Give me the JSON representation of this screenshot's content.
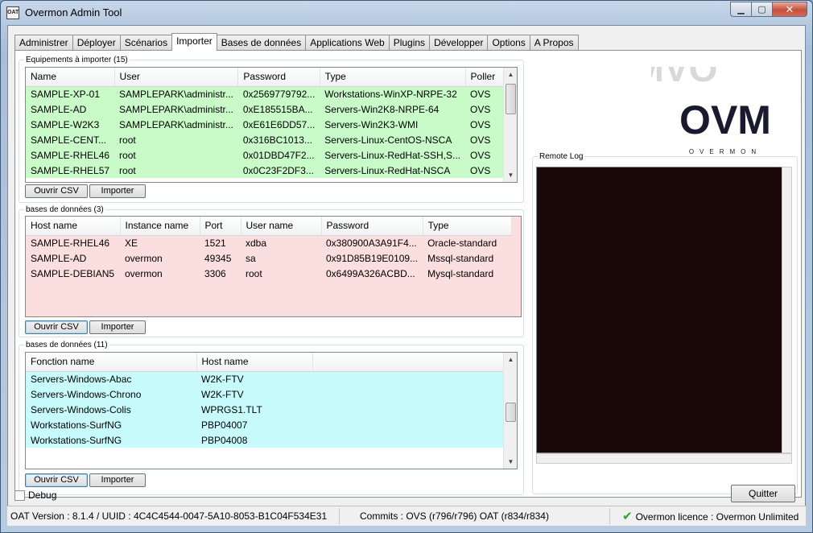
{
  "window": {
    "title": "Overmon Admin Tool",
    "app_icon_text": "OAT"
  },
  "tabs": [
    {
      "label": "Administrer"
    },
    {
      "label": "Déployer"
    },
    {
      "label": "Scénarios"
    },
    {
      "label": "Importer"
    },
    {
      "label": "Bases de données"
    },
    {
      "label": "Applications Web"
    },
    {
      "label": "Plugins"
    },
    {
      "label": "Développer"
    },
    {
      "label": "Options"
    },
    {
      "label": "A Propos"
    }
  ],
  "active_tab": "Importer",
  "equipements": {
    "legend": "Equipements à importer (15)",
    "columns": [
      "Name",
      "User",
      "Password",
      "Type",
      "Poller"
    ],
    "rows": [
      [
        "SAMPLE-XP-01",
        "SAMPLEPARK\\administr...",
        "0x2569779792...",
        "Workstations-WinXP-NRPE-32",
        "OVS"
      ],
      [
        "SAMPLE-AD",
        "SAMPLEPARK\\administr...",
        "0xE185515BA...",
        "Servers-Win2K8-NRPE-64",
        "OVS"
      ],
      [
        "SAMPLE-W2K3",
        "SAMPLEPARK\\administr...",
        "0xE61E6DD57...",
        "Servers-Win2K3-WMI",
        "OVS"
      ],
      [
        "SAMPLE-CENT...",
        "root",
        "0x316BC1013...",
        "Servers-Linux-CentOS-NSCA",
        "OVS"
      ],
      [
        "SAMPLE-RHEL46",
        "root",
        "0x01DBD47F2...",
        "Servers-Linux-RedHat-SSH,S...",
        "OVS"
      ],
      [
        "SAMPLE-RHEL57",
        "root",
        "0x0C23F2DF3...",
        "Servers-Linux-RedHat-NSCA",
        "OVS"
      ]
    ],
    "buttons": {
      "open": "Ouvrir CSV",
      "import": "Importer"
    }
  },
  "databases": {
    "legend": "bases de données (3)",
    "columns": [
      "Host name",
      "Instance name",
      "Port",
      "User name",
      "Password",
      "Type"
    ],
    "rows": [
      [
        "SAMPLE-RHEL46",
        "XE",
        "1521",
        "xdba",
        "0x380900A3A91F4...",
        "Oracle-standard"
      ],
      [
        "SAMPLE-AD",
        "overmon",
        "49345",
        "sa",
        "0x91D85B19E0109...",
        "Mssql-standard"
      ],
      [
        "SAMPLE-DEBIAN5",
        "overmon",
        "3306",
        "root",
        "0x6499A326ACBD...",
        "Mysql-standard"
      ]
    ],
    "buttons": {
      "open": "Ouvrir CSV",
      "import": "Importer"
    }
  },
  "functions": {
    "legend": "bases de données (11)",
    "columns": [
      "Fonction name",
      "Host name"
    ],
    "rows": [
      [
        "Servers-Windows-Abac",
        "W2K-FTV"
      ],
      [
        "Servers-Windows-Chrono",
        "W2K-FTV"
      ],
      [
        "Servers-Windows-Colis",
        "WPRGS1.TLT"
      ],
      [
        "Workstations-SurfNG",
        "PBP04007"
      ],
      [
        "Workstations-SurfNG",
        "PBP04008"
      ]
    ],
    "buttons": {
      "open": "Ouvrir CSV",
      "import": "Importer"
    }
  },
  "logo": {
    "big": "OVM",
    "small": "OVERMON"
  },
  "remote_log": {
    "legend": "Remote Log"
  },
  "debug": {
    "label": "Debug"
  },
  "quit": {
    "label": "Quitter"
  },
  "status": {
    "version": "OAT Version : 8.1.4 / UUID : 4C4C4544-0047-5A10-8053-B1C04F534E31",
    "commits": "Commits : OVS (r796/r796) OAT (r834/r834)",
    "licence": "Overmon licence : Overmon Unlimited"
  },
  "colors": {
    "green_rows": "#c8fbc8",
    "pink_rows": "#fbdede",
    "cyan_rows": "#c8fbfb",
    "log_bg": "#1a0707",
    "check": "#2ea02e"
  }
}
